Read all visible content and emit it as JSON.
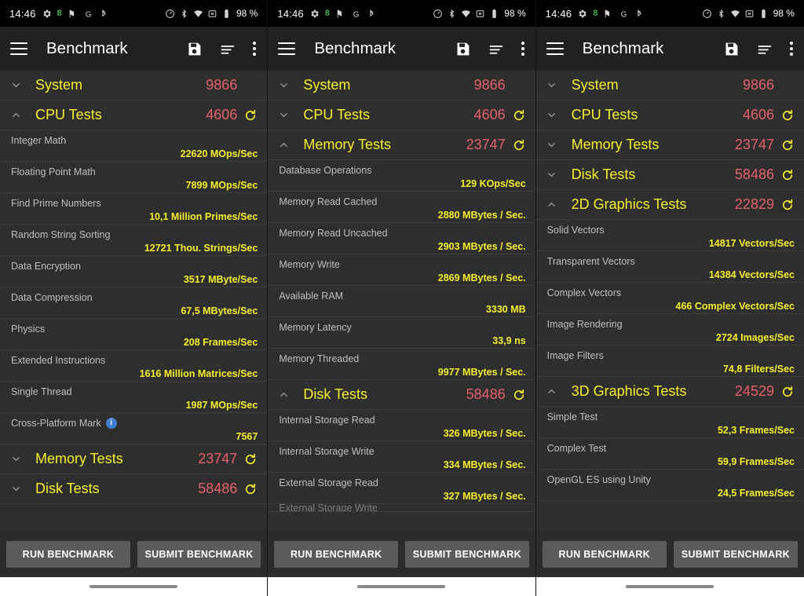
{
  "statusbar": {
    "time": "14:46",
    "left_icons": [
      "gear-icon",
      "green-indicator-icon",
      "flag-icon",
      "google-icon",
      "bluetooth-share-icon"
    ],
    "green_glyph": "8",
    "google_glyph": "G",
    "right_icons": [
      "speedometer-icon",
      "bluetooth-icon",
      "wifi-icon",
      "no-sim-icon",
      "battery-icon"
    ],
    "battery": "98 %"
  },
  "appbar": {
    "title": "Benchmark",
    "menu_icon": "hamburger-menu-icon",
    "save_icon": "save-floppy-icon",
    "sort_icon": "sort-lines-icon",
    "overflow_icon": "overflow-dots-icon"
  },
  "buttons": {
    "run": "RUN BENCHMARK",
    "submit": "SUBMIT BENCHMARK"
  },
  "panels": [
    {
      "rows": [
        {
          "kind": "group",
          "label": "System",
          "score": "9866",
          "expanded": false,
          "refresh": false
        },
        {
          "kind": "group",
          "label": "CPU Tests",
          "score": "4606",
          "expanded": true,
          "refresh": true
        },
        {
          "kind": "test",
          "name": "Integer Math",
          "value": "22620 MOps/Sec"
        },
        {
          "kind": "test",
          "name": "Floating Point Math",
          "value": "7899 MOps/Sec"
        },
        {
          "kind": "test",
          "name": "Find Prime Numbers",
          "value": "10,1 Million Primes/Sec"
        },
        {
          "kind": "test",
          "name": "Random String Sorting",
          "value": "12721 Thou. Strings/Sec"
        },
        {
          "kind": "test",
          "name": "Data Encryption",
          "value": "3517 MByte/Sec"
        },
        {
          "kind": "test",
          "name": "Data Compression",
          "value": "67,5 MBytes/Sec"
        },
        {
          "kind": "test",
          "name": "Physics",
          "value": "208 Frames/Sec"
        },
        {
          "kind": "test",
          "name": "Extended Instructions",
          "value": "1616 Million Matrices/Sec"
        },
        {
          "kind": "test",
          "name": "Single Thread",
          "value": "1987 MOps/Sec"
        },
        {
          "kind": "test",
          "name": "Cross-Platform Mark",
          "value": "7567",
          "badge": "i"
        },
        {
          "kind": "group",
          "label": "Memory Tests",
          "score": "23747",
          "expanded": false,
          "refresh": true
        },
        {
          "kind": "group",
          "label": "Disk Tests",
          "score": "58486",
          "expanded": false,
          "refresh": true
        }
      ]
    },
    {
      "rows": [
        {
          "kind": "group",
          "label": "System",
          "score": "9866",
          "expanded": false,
          "refresh": false
        },
        {
          "kind": "group",
          "label": "CPU Tests",
          "score": "4606",
          "expanded": false,
          "refresh": true
        },
        {
          "kind": "group",
          "label": "Memory Tests",
          "score": "23747",
          "expanded": true,
          "refresh": true
        },
        {
          "kind": "test",
          "name": "Database Operations",
          "value": "129 KOps/Sec"
        },
        {
          "kind": "test",
          "name": "Memory Read Cached",
          "value": "2880 MBytes / Sec."
        },
        {
          "kind": "test",
          "name": "Memory Read Uncached",
          "value": "2903 MBytes / Sec."
        },
        {
          "kind": "test",
          "name": "Memory Write",
          "value": "2869 MBytes / Sec."
        },
        {
          "kind": "test",
          "name": "Available RAM",
          "value": "3330 MB"
        },
        {
          "kind": "test",
          "name": "Memory Latency",
          "value": "33,9 ns"
        },
        {
          "kind": "test",
          "name": "Memory Threaded",
          "value": "9977 MBytes / Sec."
        },
        {
          "kind": "group",
          "label": "Disk Tests",
          "score": "58486",
          "expanded": true,
          "refresh": true
        },
        {
          "kind": "test",
          "name": "Internal Storage Read",
          "value": "326 MBytes / Sec."
        },
        {
          "kind": "test",
          "name": "Internal Storage Write",
          "value": "334 MBytes / Sec."
        },
        {
          "kind": "test",
          "name": "External Storage Read",
          "value": "327 MBytes / Sec."
        },
        {
          "kind": "test",
          "name": "External Storage Write",
          "value": "",
          "clipped": true
        }
      ]
    },
    {
      "rows": [
        {
          "kind": "group",
          "label": "System",
          "score": "9866",
          "expanded": false,
          "refresh": false
        },
        {
          "kind": "group",
          "label": "CPU Tests",
          "score": "4606",
          "expanded": false,
          "refresh": true
        },
        {
          "kind": "group",
          "label": "Memory Tests",
          "score": "23747",
          "expanded": false,
          "refresh": true
        },
        {
          "kind": "group",
          "label": "Disk Tests",
          "score": "58486",
          "expanded": false,
          "refresh": true
        },
        {
          "kind": "group",
          "label": "2D Graphics Tests",
          "score": "22829",
          "expanded": true,
          "refresh": true
        },
        {
          "kind": "test",
          "name": "Solid Vectors",
          "value": "14817 Vectors/Sec"
        },
        {
          "kind": "test",
          "name": "Transparent Vectors",
          "value": "14384 Vectors/Sec"
        },
        {
          "kind": "test",
          "name": "Complex Vectors",
          "value": "466 Complex Vectors/Sec"
        },
        {
          "kind": "test",
          "name": "Image Rendering",
          "value": "2724 Images/Sec"
        },
        {
          "kind": "test",
          "name": "Image Filters",
          "value": "74,8 Filters/Sec"
        },
        {
          "kind": "group",
          "label": "3D Graphics Tests",
          "score": "24529",
          "expanded": true,
          "refresh": true
        },
        {
          "kind": "test",
          "name": "Simple Test",
          "value": "52,3 Frames/Sec"
        },
        {
          "kind": "test",
          "name": "Complex Test",
          "value": "59,9 Frames/Sec"
        },
        {
          "kind": "test",
          "name": "OpenGL ES using Unity",
          "value": "24,5 Frames/Sec"
        }
      ]
    }
  ],
  "colors": {
    "group_label": "#f5f02b",
    "group_score": "#e5606b",
    "test_value": "#f5f02b",
    "test_name": "#bfbfbf",
    "background": "#2e2e2e",
    "appbar": "#212121",
    "statusbar": "#000000",
    "button": "#5b5b5b"
  }
}
